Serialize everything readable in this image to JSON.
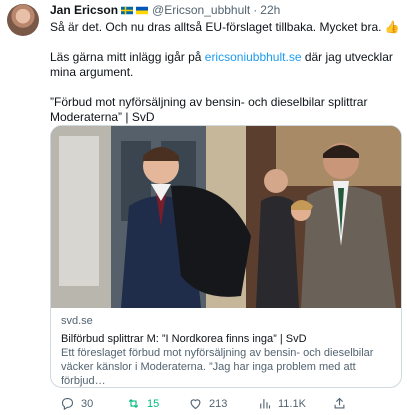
{
  "author": {
    "name": "Jan Ericson",
    "handle": "@Ericson_ubbhult",
    "separator": "·",
    "time": "22h"
  },
  "tweet": {
    "line1": "Så är det. Och nu dras alltså EU-förslaget tillbaka. Mycket bra. 👍",
    "line2_pre": "Läs gärna mitt inlägg igår på ",
    "line2_link": "ericsoniubbhult.se",
    "line2_post": " där jag utvecklar mina argument.",
    "line3": "”Förbud mot nyförsäljning av bensin- och dieselbilar splittrar Moderaterna” | SvD"
  },
  "card": {
    "domain": "svd.se",
    "title": "Bilförbud splittrar M: ”I Nordkorea finns inga” | SvD",
    "description": "Ett föreslaget förbud mot nyförsäljning av bensin- och dieselbilar väcker känslor i Moderaterna. ”Jag har inga problem med att förbjud…"
  },
  "actions": {
    "replies": "30",
    "retweets": "15",
    "likes": "213",
    "views": "11.1K"
  },
  "colors": {
    "link": "#1d9bf0",
    "retweet": "#00ba7c",
    "muted": "#536471"
  }
}
